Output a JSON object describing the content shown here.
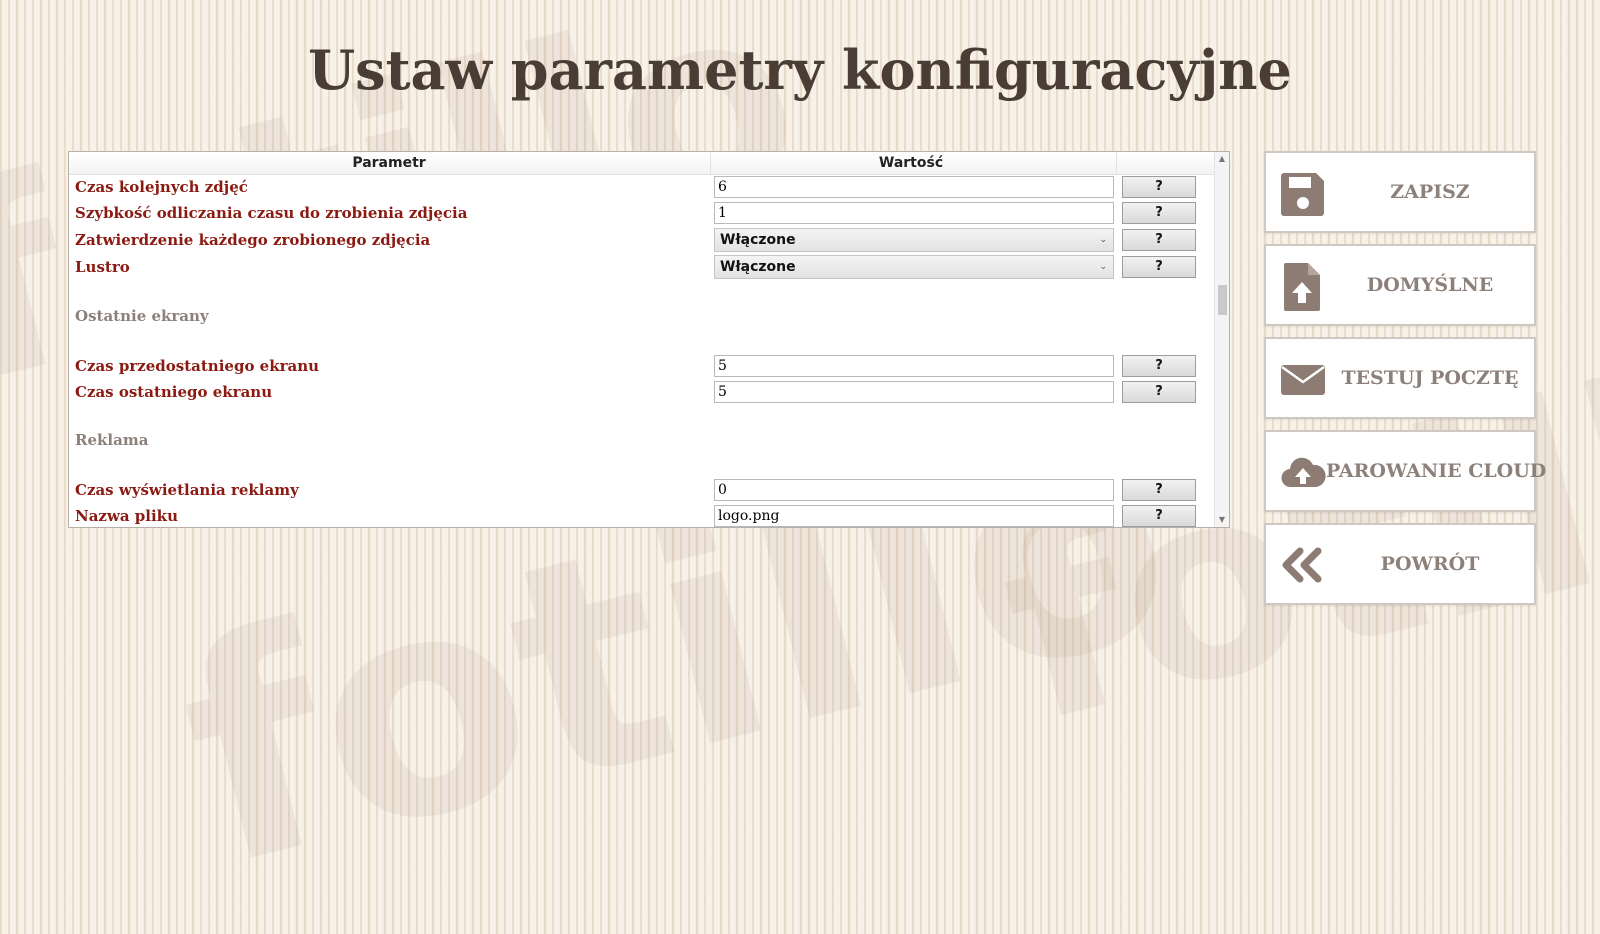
{
  "watermark": {
    "text": "fotillo"
  },
  "page": {
    "title": "Ustaw parametry konfiguracyjne"
  },
  "table": {
    "header": {
      "param": "Parametr",
      "value": "Wartość"
    },
    "help_label": "?",
    "rows": [
      {
        "kind": "input",
        "label": "Czas kolejnych zdjęć",
        "value": "6"
      },
      {
        "kind": "input",
        "label": "Szybkość odliczania czasu do zrobienia zdjęcia",
        "value": "1"
      },
      {
        "kind": "select",
        "label": "Zatwierdzenie każdego zrobionego zdjęcia",
        "value": "Włączone"
      },
      {
        "kind": "select",
        "label": "Lustro",
        "value": "Włączone"
      },
      {
        "kind": "section",
        "label": "Ostatnie ekrany"
      },
      {
        "kind": "input",
        "label": "Czas przedostatniego ekranu",
        "value": "5"
      },
      {
        "kind": "input",
        "label": "Czas ostatniego ekranu",
        "value": "5"
      },
      {
        "kind": "section",
        "label": "Reklama"
      },
      {
        "kind": "input",
        "label": "Czas wyświetlania reklamy",
        "value": "0"
      },
      {
        "kind": "input",
        "label": "Nazwa pliku",
        "value": "logo.png"
      }
    ]
  },
  "sidebar": {
    "buttons": [
      {
        "id": "save",
        "label": "ZAPISZ",
        "icon": "floppy-disk-icon"
      },
      {
        "id": "defaults",
        "label": "DOMYŚLNE",
        "icon": "file-upload-icon"
      },
      {
        "id": "test-mail",
        "label": "TESTUJ POCZTĘ",
        "icon": "envelope-icon"
      },
      {
        "id": "cloud-pair",
        "label": "PAROWANIE CLOUD",
        "icon": "cloud-upload-icon"
      },
      {
        "id": "back",
        "label": "POWRÓT",
        "icon": "double-chevron-left-icon"
      }
    ]
  },
  "colors": {
    "label_red": "#8a1a12",
    "section_gray": "#8c807a",
    "title": "#4a3d36",
    "icon": "#8c7c73"
  }
}
